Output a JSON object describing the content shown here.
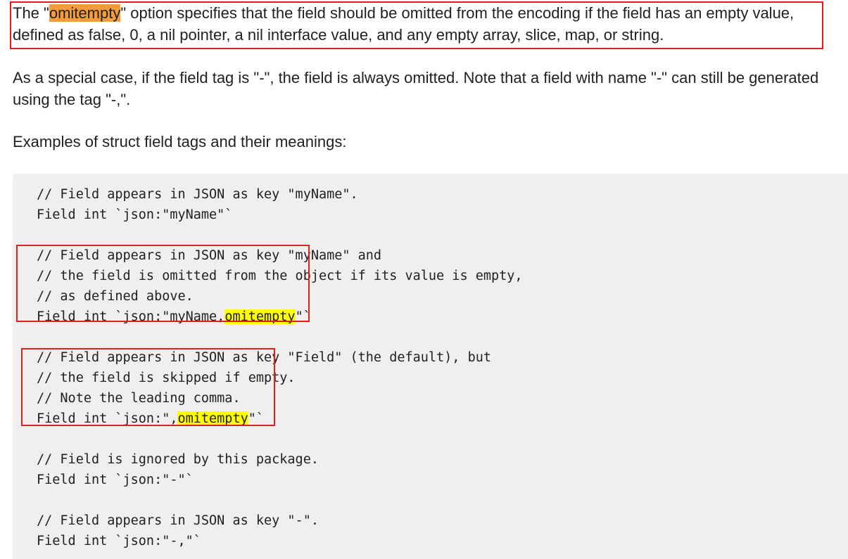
{
  "paragraphs": {
    "omitempty": {
      "before": "The \"",
      "highlight": "omitempty",
      "after": "\" option specifies that the field should be omitted from the encoding if the field has an empty value, defined as false, 0, a nil pointer, a nil interface value, and any empty array, slice, map, or string."
    },
    "special_case": "As a special case, if the field tag is \"-\", the field is always omitted. Note that a field with name \"-\" can still be generated using the tag \"-,\".",
    "examples_intro": "Examples of struct field tags and their meanings:"
  },
  "code": {
    "ex1": {
      "comment": "// Field appears in JSON as key \"myName\".",
      "code": "Field int `json:\"myName\"`"
    },
    "ex2": {
      "comment1": "// Field appears in JSON as key \"myName\" and",
      "comment2": "// the field is omitted from the object if its value is empty,",
      "comment3": "// as defined above.",
      "code_before": "Field int `json:\"myName,",
      "code_highlight": "omitempty",
      "code_after": "\"`"
    },
    "ex3": {
      "comment1": "// Field appears in JSON as key \"Field\" (the default), but",
      "comment2": "// the field is skipped if empty.",
      "comment3": "// Note the leading comma.",
      "code_before": "Field int `json:\",",
      "code_highlight": "omitempty",
      "code_after": "\"`"
    },
    "ex4": {
      "comment": "// Field is ignored by this package.",
      "code": "Field int `json:\"-\"`"
    },
    "ex5": {
      "comment": "// Field appears in JSON as key \"-\".",
      "code": "Field int `json:\"-,\"`"
    }
  },
  "colors": {
    "annotation_box": "#e0201c",
    "orange_highlight": "#f39c3c",
    "yellow_highlight": "#ffff00",
    "code_background": "#efefef"
  }
}
